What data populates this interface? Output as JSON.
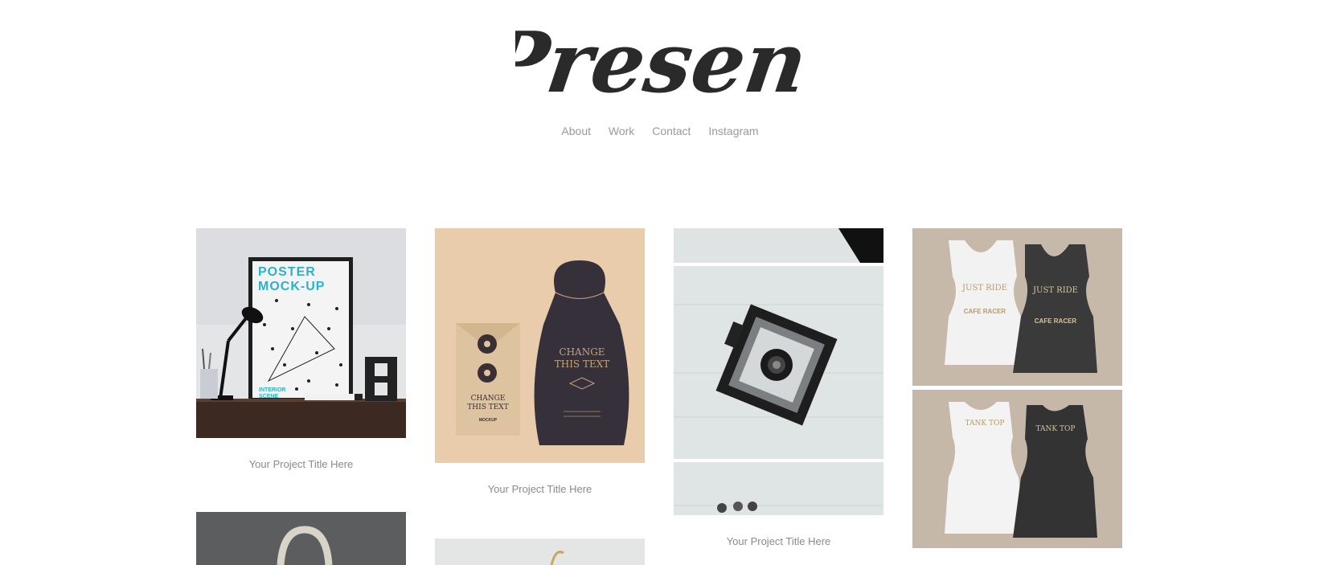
{
  "brand": {
    "logo_text": "Present"
  },
  "nav": {
    "items": [
      {
        "label": "About"
      },
      {
        "label": "Work"
      },
      {
        "label": "Contact"
      },
      {
        "label": "Instagram"
      }
    ]
  },
  "projects": [
    {
      "title": "Your Project Title Here",
      "image": "poster-mockup-image",
      "image_text": [
        "POSTER",
        "MOCK-UP",
        "INTERIOR",
        "SCENE"
      ]
    },
    {
      "title": "Your Project Title Here",
      "image": "bag-mockup-image",
      "image_text": [
        "CHANGE",
        "THIS TEXT",
        "CHANGE",
        "THIS TEXT",
        "MOCKUP"
      ]
    },
    {
      "title": "Your Project Title Here",
      "image": "vintage-camera-image"
    },
    {
      "title": "",
      "image": "tank-top-mockup-image",
      "image_text": [
        "JUST RIDE",
        "CAFE RACER",
        "JUST RIDE",
        "CAFE RACER",
        "TANK TOP",
        "TANK TOP"
      ]
    }
  ],
  "colors": {
    "nav_text": "#9a9a9a",
    "caption_text": "#8a8a8a",
    "logo": "#2a2a2a",
    "accent_teal": "#2ab3c8"
  }
}
